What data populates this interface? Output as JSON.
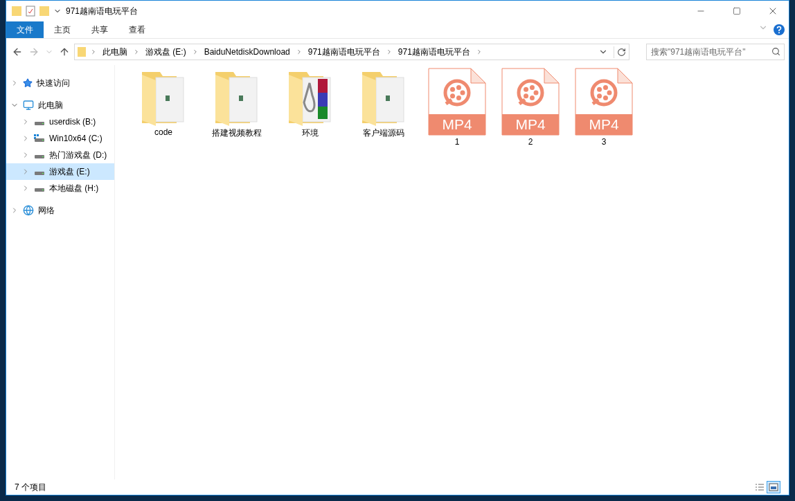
{
  "window": {
    "title": "971越南语电玩平台"
  },
  "ribbon_tabs": [
    {
      "label": "文件",
      "selected": true
    },
    {
      "label": "主页",
      "selected": false
    },
    {
      "label": "共享",
      "selected": false
    },
    {
      "label": "查看",
      "selected": false
    }
  ],
  "address": {
    "crumbs": [
      "此电脑",
      "游戏盘 (E:)",
      "BaiduNetdiskDownload",
      "971越南语电玩平台",
      "971越南语电玩平台"
    ]
  },
  "search": {
    "placeholder": "搜索\"971越南语电玩平台\""
  },
  "sidebar": {
    "items": [
      {
        "label": "快速访问",
        "kind": "star",
        "expanded": false,
        "selected": false
      },
      {
        "label": "此电脑",
        "kind": "pc",
        "expanded": true,
        "selected": false,
        "children": [
          {
            "label": "userdisk (B:)",
            "kind": "drive",
            "expanded": false,
            "selected": false
          },
          {
            "label": "Win10x64 (C:)",
            "kind": "system",
            "expanded": false,
            "selected": false
          },
          {
            "label": "热门游戏盘 (D:)",
            "kind": "drive",
            "expanded": false,
            "selected": false
          },
          {
            "label": "游戏盘 (E:)",
            "kind": "drive",
            "expanded": false,
            "selected": true
          },
          {
            "label": "本地磁盘 (H:)",
            "kind": "drive",
            "expanded": false,
            "selected": false
          }
        ]
      },
      {
        "label": "网络",
        "kind": "network",
        "expanded": false,
        "selected": false
      }
    ]
  },
  "files": [
    {
      "name": "code",
      "kind": "folder"
    },
    {
      "name": "搭建视频教程",
      "kind": "folder"
    },
    {
      "name": "环境",
      "kind": "archive-folder"
    },
    {
      "name": "客户端源码",
      "kind": "folder"
    },
    {
      "name": "1",
      "kind": "video",
      "badge": "MP4"
    },
    {
      "name": "2",
      "kind": "video",
      "badge": "MP4"
    },
    {
      "name": "3",
      "kind": "video",
      "badge": "MP4"
    }
  ],
  "status_bar": {
    "count": "7 个项目",
    "views": [
      {
        "kind": "details",
        "selected": false
      },
      {
        "kind": "icons",
        "selected": true
      }
    ]
  }
}
